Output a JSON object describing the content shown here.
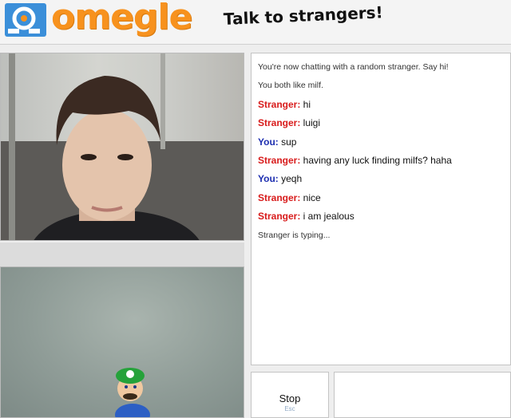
{
  "header": {
    "logo_text": "omegle",
    "tagline": "Talk to strangers!"
  },
  "colors": {
    "brand_orange": "#f7921e",
    "brand_blue": "#3b8fd9",
    "stranger_label": "#d81b1b",
    "you_label": "#1e2fb0"
  },
  "chat": {
    "system_top": [
      "You're now chatting with a random stranger. Say hi!",
      "You both like milf."
    ],
    "messages": [
      {
        "sender": "Stranger:",
        "text": " hi"
      },
      {
        "sender": "Stranger:",
        "text": " luigi"
      },
      {
        "sender": "You:",
        "text": " sup"
      },
      {
        "sender": "Stranger:",
        "text": " having any luck finding milfs? haha"
      },
      {
        "sender": "You:",
        "text": " yeqh"
      },
      {
        "sender": "Stranger:",
        "text": " nice"
      },
      {
        "sender": "Stranger:",
        "text": " i am jealous"
      }
    ],
    "typing": "Stranger is typing..."
  },
  "controls": {
    "stop_label": "Stop",
    "stop_key": "Esc",
    "message_value": ""
  },
  "icons": {
    "logo": "omegle-logo-icon",
    "figure": "luigi-figure"
  }
}
